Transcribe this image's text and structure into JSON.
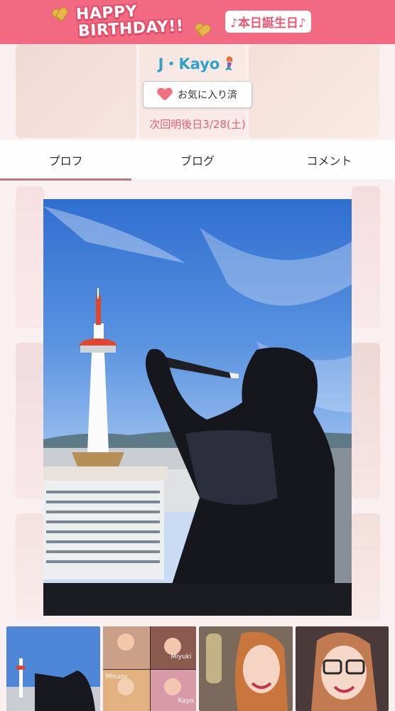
{
  "banner": {
    "birthday_line1": "HAPPY",
    "birthday_line2": "BIRTHDAY!!",
    "today_label": "♪本日誕生日♪",
    "accent": "#f26a82"
  },
  "profile": {
    "name": "J・Kayo",
    "name_icon": "mermaid-icon",
    "favorite_label": "お気に入り済",
    "favorite_icon": "heart-icon",
    "next_work": "次回明後日3/28(土)"
  },
  "tabs": [
    {
      "label": "プロフ",
      "active": true
    },
    {
      "label": "ブログ",
      "active": false
    },
    {
      "label": "コメント",
      "active": false
    }
  ],
  "gallery": {
    "main_photo": "kyoto-tower-silhouette-photo",
    "thumbnails": [
      {
        "name": "thumb-kyoto-tower",
        "selected": true
      },
      {
        "name": "thumb-collage",
        "selected": false,
        "labels": [
          "Miyuki",
          "Misuzu",
          "Kayo"
        ]
      },
      {
        "name": "thumb-selfie-champagne",
        "selected": false
      },
      {
        "name": "thumb-selfie-glasses",
        "selected": false
      }
    ]
  },
  "colors": {
    "name": "#2ea2c6",
    "next_work": "#e0607a",
    "tab_indicator": "#b87a7e"
  }
}
